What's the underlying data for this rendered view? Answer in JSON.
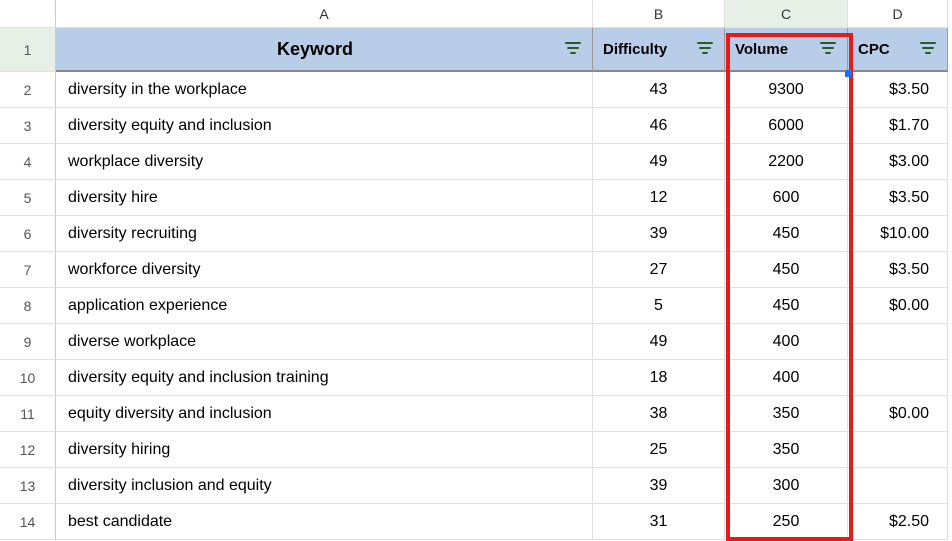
{
  "columns": [
    "A",
    "B",
    "C",
    "D"
  ],
  "row_numbers": [
    1,
    2,
    3,
    4,
    5,
    6,
    7,
    8,
    9,
    10,
    11,
    12,
    13,
    14
  ],
  "headers": {
    "keyword": "Keyword",
    "difficulty": "Difficulty",
    "volume": "Volume",
    "cpc": "CPC"
  },
  "rows": [
    {
      "keyword": "diversity in the workplace",
      "difficulty": "43",
      "volume": "9300",
      "cpc": "$3.50"
    },
    {
      "keyword": "diversity equity and inclusion",
      "difficulty": "46",
      "volume": "6000",
      "cpc": "$1.70"
    },
    {
      "keyword": "workplace diversity",
      "difficulty": "49",
      "volume": "2200",
      "cpc": "$3.00"
    },
    {
      "keyword": "diversity hire",
      "difficulty": "12",
      "volume": "600",
      "cpc": "$3.50"
    },
    {
      "keyword": "diversity recruiting",
      "difficulty": "39",
      "volume": "450",
      "cpc": "$10.00"
    },
    {
      "keyword": "workforce diversity",
      "difficulty": "27",
      "volume": "450",
      "cpc": "$3.50"
    },
    {
      "keyword": "application experience",
      "difficulty": "5",
      "volume": "450",
      "cpc": "$0.00"
    },
    {
      "keyword": "diverse workplace",
      "difficulty": "49",
      "volume": "400",
      "cpc": ""
    },
    {
      "keyword": "diversity equity and inclusion training",
      "difficulty": "18",
      "volume": "400",
      "cpc": ""
    },
    {
      "keyword": "equity diversity and inclusion",
      "difficulty": "38",
      "volume": "350",
      "cpc": "$0.00"
    },
    {
      "keyword": "diversity hiring",
      "difficulty": "25",
      "volume": "350",
      "cpc": ""
    },
    {
      "keyword": "diversity inclusion and equity",
      "difficulty": "39",
      "volume": "300",
      "cpc": ""
    },
    {
      "keyword": "best candidate",
      "difficulty": "31",
      "volume": "250",
      "cpc": "$2.50"
    }
  ],
  "highlighted_column": "C",
  "chart_data": {
    "type": "table",
    "title": "Keyword metrics",
    "columns": [
      "Keyword",
      "Difficulty",
      "Volume",
      "CPC"
    ],
    "rows": [
      [
        "diversity in the workplace",
        43,
        9300,
        3.5
      ],
      [
        "diversity equity and inclusion",
        46,
        6000,
        1.7
      ],
      [
        "workplace diversity",
        49,
        2200,
        3.0
      ],
      [
        "diversity hire",
        12,
        600,
        3.5
      ],
      [
        "diversity recruiting",
        39,
        450,
        10.0
      ],
      [
        "workforce diversity",
        27,
        450,
        3.5
      ],
      [
        "application experience",
        5,
        450,
        0.0
      ],
      [
        "diverse workplace",
        49,
        400,
        null
      ],
      [
        "diversity equity and inclusion training",
        18,
        400,
        null
      ],
      [
        "equity diversity and inclusion",
        38,
        350,
        0.0
      ],
      [
        "diversity hiring",
        25,
        350,
        null
      ],
      [
        "diversity inclusion and equity",
        39,
        300,
        null
      ],
      [
        "best candidate",
        31,
        250,
        2.5
      ]
    ]
  }
}
